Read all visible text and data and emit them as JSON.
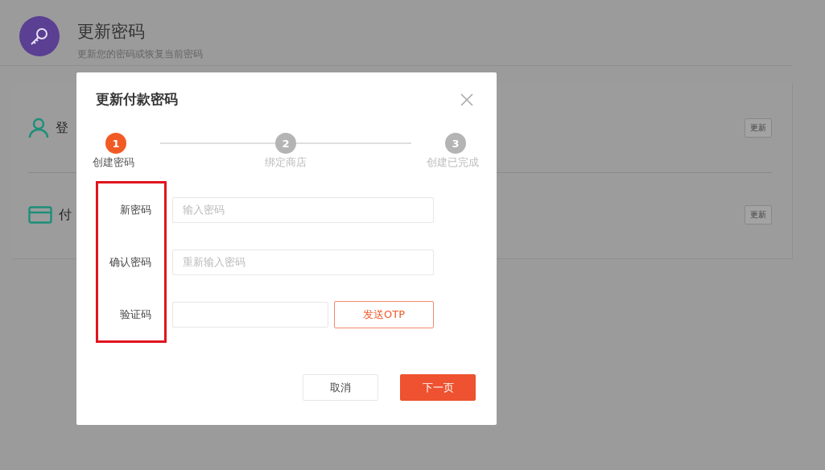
{
  "page_header": {
    "title": "更新密码",
    "subtitle": "更新您的密码或恢复当前密码"
  },
  "settings_rows": [
    {
      "kind": "user",
      "label": "登",
      "button": "更新"
    },
    {
      "kind": "card",
      "label": "付",
      "button": "更新"
    }
  ],
  "dialog": {
    "title": "更新付款密码",
    "steps": [
      {
        "number": "1",
        "label": "创建密码",
        "active": true
      },
      {
        "number": "2",
        "label": "绑定商店",
        "active": false
      },
      {
        "number": "3",
        "label": "创建已完成",
        "active": false
      }
    ],
    "fields": [
      {
        "label": "新密码",
        "placeholder": "输入密码"
      },
      {
        "label": "确认密码",
        "placeholder": "重新输入密码"
      },
      {
        "label": "验证码",
        "button": "发送OTP"
      }
    ],
    "highlighted_labels": true,
    "buttons": [
      {
        "label": "取消",
        "kind": "secondary"
      },
      {
        "label": "下一页",
        "kind": "primary"
      }
    ]
  }
}
